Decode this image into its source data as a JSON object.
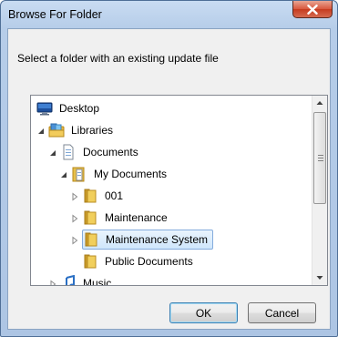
{
  "dialog": {
    "title": "Browse For Folder",
    "prompt": "Select a folder with an existing update file"
  },
  "tree": {
    "items": [
      {
        "label": "Desktop",
        "icon": "desktop-icon",
        "expander": "none"
      },
      {
        "label": "Libraries",
        "icon": "libraries-icon",
        "expander": "expanded"
      },
      {
        "label": "Documents",
        "icon": "documents-library-icon",
        "expander": "expanded"
      },
      {
        "label": "My Documents",
        "icon": "my-documents-icon",
        "expander": "expanded"
      },
      {
        "label": "001",
        "icon": "folder-icon",
        "expander": "collapsed"
      },
      {
        "label": "Maintenance",
        "icon": "folder-icon",
        "expander": "collapsed"
      },
      {
        "label": "Maintenance System",
        "icon": "folder-icon",
        "expander": "collapsed",
        "selected": true
      },
      {
        "label": "Public Documents",
        "icon": "folder-icon",
        "expander": "none"
      },
      {
        "label": "Music",
        "icon": "music-library-icon",
        "expander": "collapsed"
      }
    ]
  },
  "buttons": {
    "ok": "OK",
    "cancel": "Cancel"
  },
  "colors": {
    "selection_border": "#84acdd",
    "close_button": "#c63b1f",
    "folder": "#e8c04a"
  }
}
